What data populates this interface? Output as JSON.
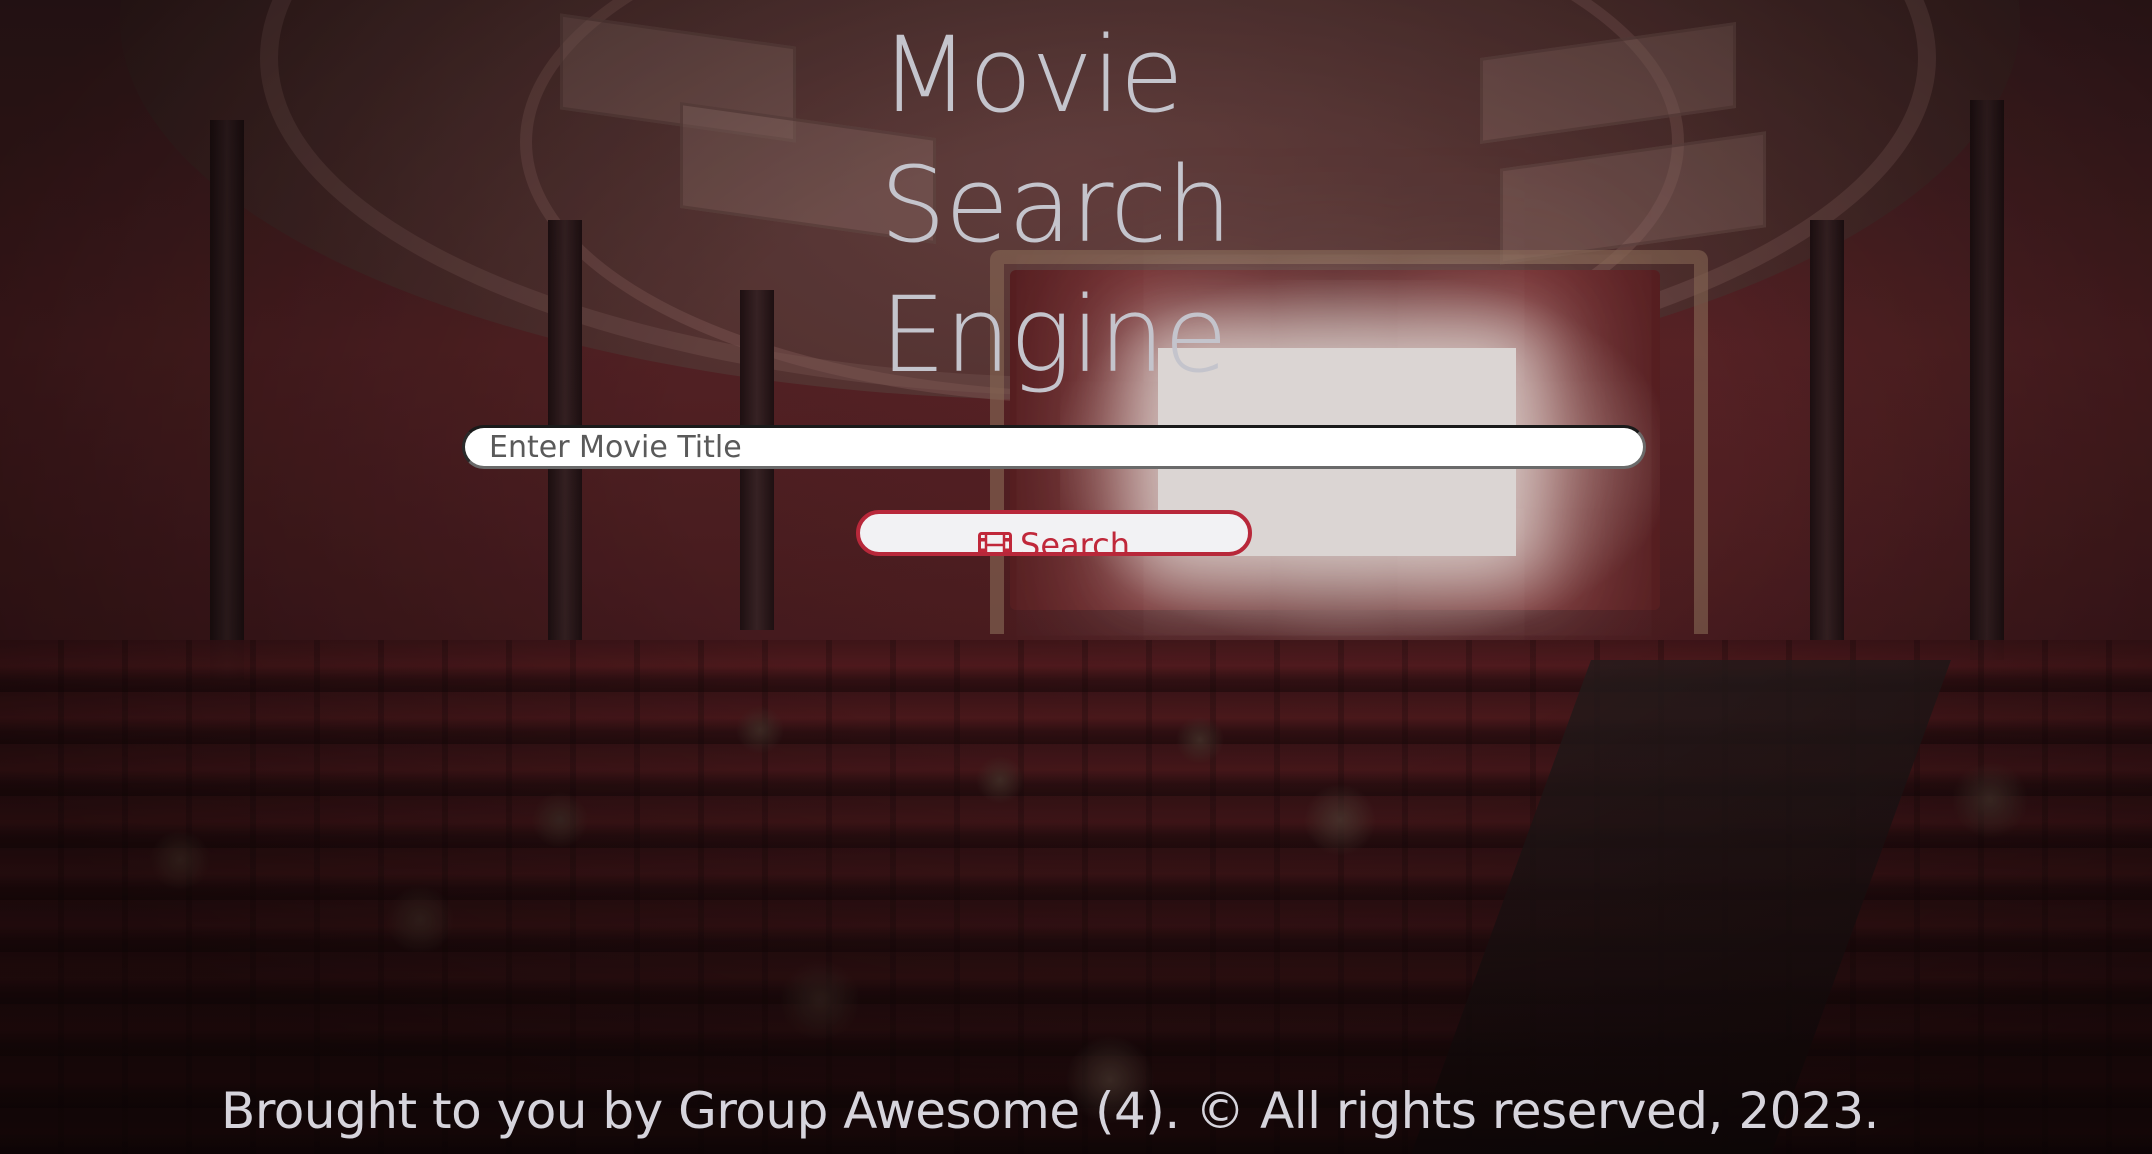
{
  "hero": {
    "title_lines": [
      "Movie",
      "Search",
      "Engine"
    ]
  },
  "search": {
    "placeholder": "Enter Movie Title",
    "value": "",
    "button_label": "Search",
    "button_icon": "film-icon"
  },
  "footer": {
    "text": "Brought to you by Group Awesome (4). © All rights reserved, 2023."
  },
  "colors": {
    "title": "#c4c4cc",
    "button_border": "#b8283a",
    "button_text": "#c0283a",
    "input_background": "#ffffff",
    "footer_text": "#d6d4dc"
  }
}
